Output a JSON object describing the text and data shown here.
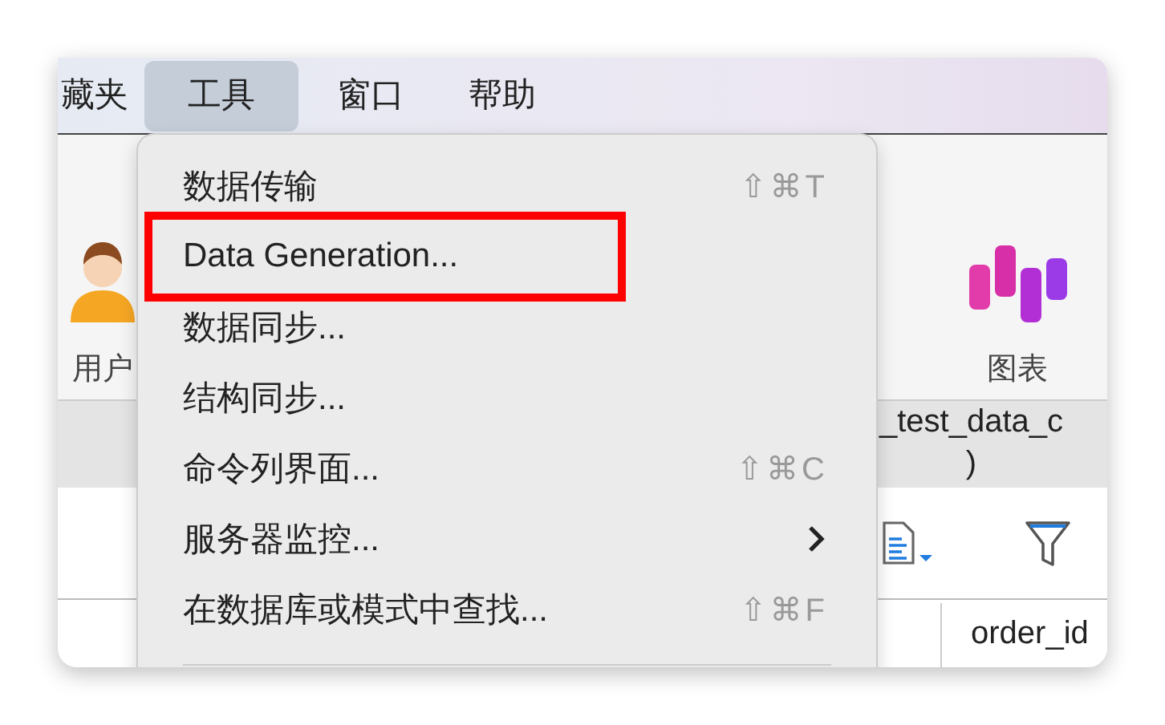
{
  "menubar": {
    "items": [
      {
        "label": "藏夹",
        "selected": false
      },
      {
        "label": "工具",
        "selected": true
      },
      {
        "label": "窗口",
        "selected": false
      },
      {
        "label": "帮助",
        "selected": false
      }
    ]
  },
  "toolbar": {
    "items": [
      {
        "label": "用户",
        "kind": "user"
      },
      {
        "label": "图表",
        "kind": "chart"
      }
    ]
  },
  "object_tab": {
    "title_lines": [
      "_test_data_c",
      ")"
    ]
  },
  "table": {
    "columns": [
      "order_id"
    ]
  },
  "menu": {
    "items": [
      {
        "label": "数据传输",
        "shortcut": "⇧⌘T",
        "submenu": false,
        "annotated": false
      },
      {
        "label": "Data Generation...",
        "submenu": false,
        "annotated": true
      },
      {
        "label": "数据同步...",
        "submenu": false,
        "annotated": false
      },
      {
        "label": "结构同步...",
        "submenu": false,
        "annotated": false
      },
      {
        "label": "命令列界面...",
        "shortcut": "⇧⌘C",
        "submenu": false,
        "annotated": false
      },
      {
        "label": "服务器监控...",
        "submenu": true,
        "annotated": false
      },
      {
        "label": "在数据库或模式中查找...",
        "shortcut": "⇧⌘F",
        "submenu": false,
        "annotated": false
      }
    ]
  }
}
